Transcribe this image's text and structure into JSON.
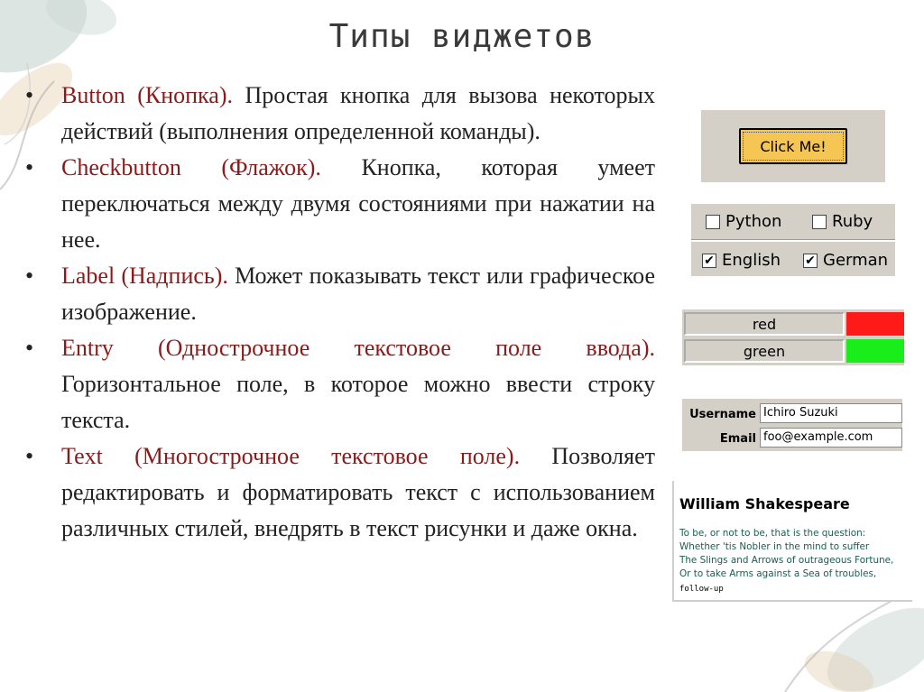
{
  "title": "Типы виджетов",
  "bullets": [
    {
      "term": "Button (Кнопка).",
      "text": " Простая кнопка для вызова некоторых действий (выполнения определенной команды)."
    },
    {
      "term": "Checkbutton (Флажок).",
      "text": " Кнопка, которая умеет переключаться между двумя состояниями при нажатии на нее."
    },
    {
      "term": "Label (Надпись).",
      "text": " Может показывать текст или графическое изображение."
    },
    {
      "term": "Entry (Однострочное текстовое поле ввода).",
      "text": " Горизонтальное поле, в которое можно ввести строку текста."
    },
    {
      "term": "Text (Многострочное текстовое поле).",
      "text": " Позволяет редактировать и форматировать текст с использованием различных стилей, внедрять в текст рисунки и даже окна."
    }
  ],
  "bullet_symbol": "•",
  "samples": {
    "button": {
      "label": "Click Me!"
    },
    "checkbuttons": [
      {
        "label": "Python",
        "checked": false,
        "mark": ""
      },
      {
        "label": "Ruby",
        "checked": false,
        "mark": ""
      },
      {
        "label": "English",
        "checked": true,
        "mark": "✔"
      },
      {
        "label": "German",
        "checked": true,
        "mark": "✔"
      }
    ],
    "labels": [
      {
        "text": "red",
        "color": "#ff1a1a"
      },
      {
        "text": "green",
        "color": "#1aee1a"
      }
    ],
    "entries": [
      {
        "label": "Username",
        "value": "Ichiro Suzuki"
      },
      {
        "label": "Email",
        "value": "foo@example.com"
      }
    ],
    "text": {
      "heading": "William Shakespeare",
      "lines": [
        "To be, or not to be, that is the question:",
        "Whether 'tis Nobler in the mind to suffer",
        "The Slings and Arrows of outrageous Fortune,",
        "Or to take Arms against a Sea of troubles,"
      ],
      "footer": "follow-up"
    }
  },
  "colors": {
    "term": "#8b1a1a",
    "button_face": "#f5c653",
    "panel_gray": "#d4d0c8",
    "text_teal": "#1a5c52"
  }
}
